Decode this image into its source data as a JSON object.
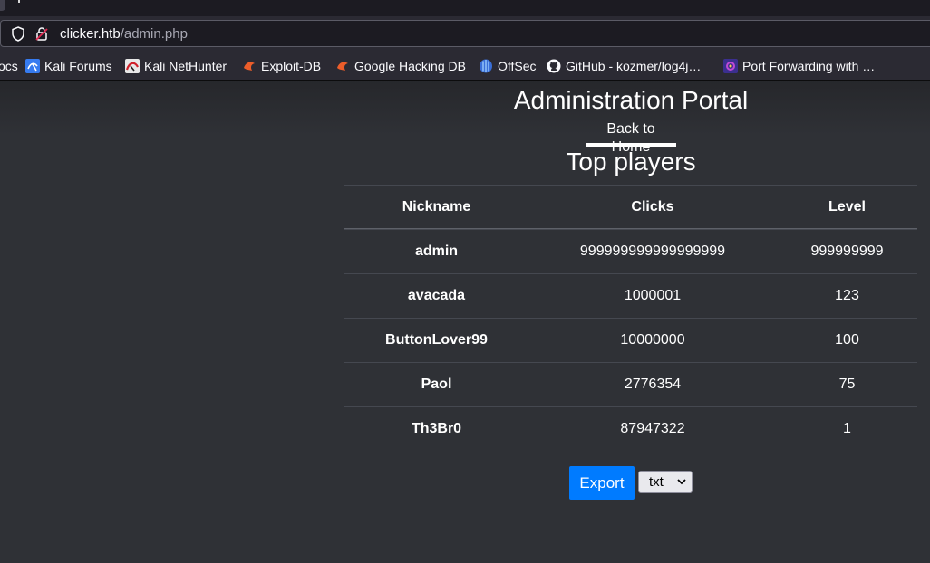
{
  "browser": {
    "url_host": "clicker.htb",
    "url_path": "/admin.php",
    "bookmarks": [
      {
        "label": "ocs",
        "icon": "none"
      },
      {
        "label": "Kali Forums",
        "icon": "kali-forums-icon"
      },
      {
        "label": "Kali NetHunter",
        "icon": "kali-nethunter-icon"
      },
      {
        "label": "Exploit-DB",
        "icon": "exploit-db-icon"
      },
      {
        "label": "Google Hacking DB",
        "icon": "google-hacking-db-icon"
      },
      {
        "label": "OffSec",
        "icon": "offsec-icon"
      },
      {
        "label": "GitHub - kozmer/log4j…",
        "icon": "github-icon"
      },
      {
        "label": "Port Forwarding with …",
        "icon": "port-forwarding-icon"
      }
    ]
  },
  "page": {
    "title": "Administration Portal",
    "back_link": "Back to Home",
    "section_title": "Top players"
  },
  "table": {
    "headers": [
      "Nickname",
      "Clicks",
      "Level"
    ],
    "rows": [
      {
        "nickname": "admin",
        "clicks": "999999999999999999",
        "level": "999999999"
      },
      {
        "nickname": "avacada",
        "clicks": "1000001",
        "level": "123"
      },
      {
        "nickname": "ButtonLover99",
        "clicks": "10000000",
        "level": "100"
      },
      {
        "nickname": "Paol",
        "clicks": "2776354",
        "level": "75"
      },
      {
        "nickname": "Th3Br0",
        "clicks": "87947322",
        "level": "1"
      }
    ]
  },
  "export": {
    "button_label": "Export",
    "format_selected": "txt"
  },
  "colors": {
    "background": "#2f3136",
    "accent": "#007bff"
  }
}
